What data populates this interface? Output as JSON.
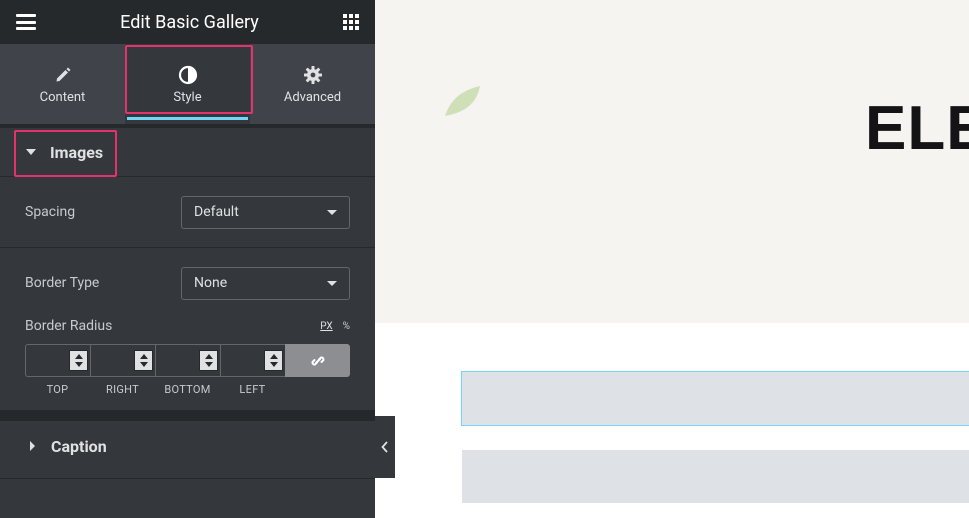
{
  "panel": {
    "title": "Edit Basic Gallery",
    "tabs": [
      {
        "label": "Content",
        "icon": "pencil-icon"
      },
      {
        "label": "Style",
        "icon": "contrast-icon"
      },
      {
        "label": "Advanced",
        "icon": "gear-icon"
      }
    ],
    "active_tab": "Style",
    "sections": {
      "images": {
        "label": "Images",
        "spacing": {
          "label": "Spacing",
          "value": "Default"
        },
        "border_type": {
          "label": "Border Type",
          "value": "None"
        },
        "border_radius": {
          "label": "Border Radius",
          "units": [
            "PX",
            "%"
          ],
          "active_unit": "PX",
          "sides": [
            "TOP",
            "RIGHT",
            "BOTTOM",
            "LEFT"
          ]
        }
      },
      "caption": {
        "label": "Caption"
      }
    }
  },
  "preview": {
    "hero_title": "ELEI"
  },
  "colors": {
    "panel_bg": "#34383c",
    "header_bg": "#26292c",
    "highlight": "#e2336a",
    "accent": "#71d7f7"
  }
}
